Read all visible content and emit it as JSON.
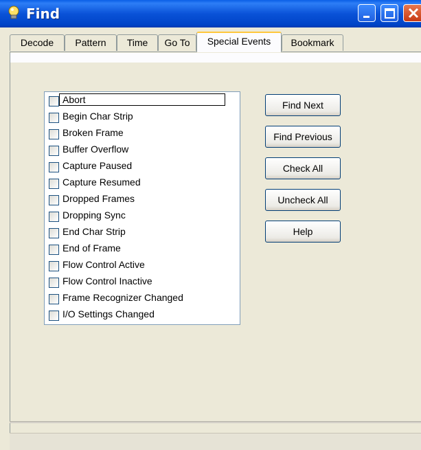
{
  "window": {
    "title": "Find"
  },
  "tabs": [
    {
      "label": "Decode",
      "active": false
    },
    {
      "label": "Pattern",
      "active": false
    },
    {
      "label": "Time",
      "active": false
    },
    {
      "label": "Go To",
      "active": false
    },
    {
      "label": "Special Events",
      "active": true
    },
    {
      "label": "Bookmark",
      "active": false
    }
  ],
  "events": [
    {
      "label": "Abort",
      "checked": false,
      "focused": true
    },
    {
      "label": "Begin Char Strip",
      "checked": false
    },
    {
      "label": "Broken Frame",
      "checked": false
    },
    {
      "label": "Buffer Overflow",
      "checked": false
    },
    {
      "label": "Capture Paused",
      "checked": false
    },
    {
      "label": "Capture Resumed",
      "checked": false
    },
    {
      "label": "Dropped Frames",
      "checked": false
    },
    {
      "label": "Dropping Sync",
      "checked": false
    },
    {
      "label": "End Char Strip",
      "checked": false
    },
    {
      "label": "End of Frame",
      "checked": false
    },
    {
      "label": "Flow Control Active",
      "checked": false
    },
    {
      "label": "Flow Control Inactive",
      "checked": false
    },
    {
      "label": "Frame Recognizer Changed",
      "checked": false
    },
    {
      "label": "I/O Settings Changed",
      "checked": false
    }
  ],
  "buttons": {
    "find_next": "Find Next",
    "find_previous": "Find Previous",
    "check_all": "Check All",
    "uncheck_all": "Uncheck All",
    "help": "Help"
  },
  "colors": {
    "titlebar": "#0a52d8",
    "active_tab_accent": "#ffc83c",
    "close_button": "#c83a14"
  }
}
